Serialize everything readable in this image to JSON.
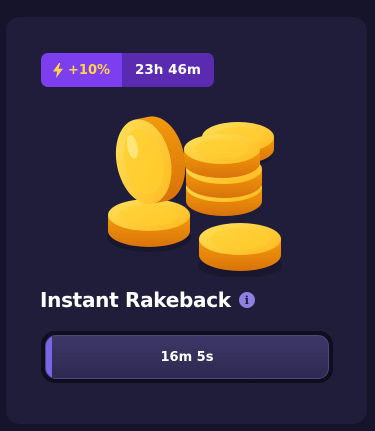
{
  "boost": {
    "percent": "+10%",
    "countdown": "23h 46m"
  },
  "rakeback": {
    "title": "Instant Rakeback",
    "info_glyph": "i",
    "timer": "16m 5s",
    "progress_fraction": 0.02
  },
  "colors": {
    "accent_purple": "#7b3ff0",
    "accent_purple_dark": "#5a2bb0",
    "bolt_yellow": "#ffd445",
    "card_bg": "#1f1d3a",
    "page_bg": "#15142a"
  },
  "icons": {
    "boost": "lightning-bolt-icon",
    "info": "info-icon",
    "illustration": "gold-coins-stack"
  }
}
